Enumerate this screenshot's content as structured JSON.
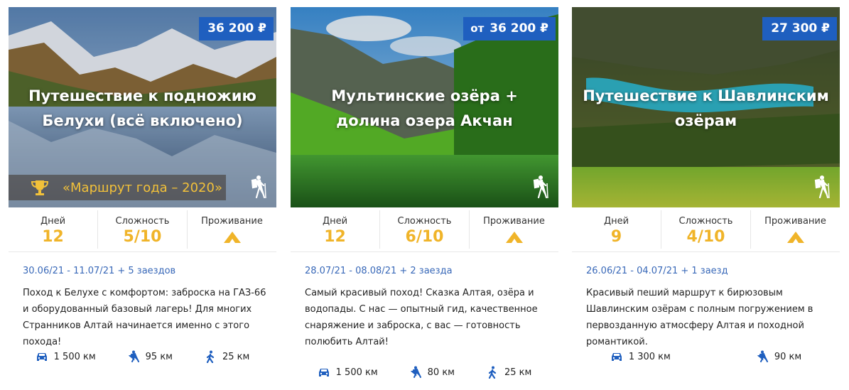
{
  "tours": [
    {
      "price_prefix": "",
      "price": "36 200 ₽",
      "title": "Путешествие к подножию Белухи (всё включено)",
      "award": "«Маршрут года – 2020»",
      "stats": {
        "days_label": "Дней",
        "days": "12",
        "difficulty_label": "Сложность",
        "difficulty": "5/10",
        "lodging_label": "Проживание",
        "lodging_icon": "tent-icon"
      },
      "dates": "30.06/21 - 11.07/21 + 5 заездов",
      "description": "Поход к Белухе с комфортом: заброска на ГАЗ-66 и оборудованный базовый лагерь! Для многих Странников Алтай начинается именно с этого похода!",
      "metrics": {
        "car": "1 500 км",
        "horse": "95 км",
        "walk": "25 км"
      }
    },
    {
      "price_prefix": "от",
      "price": "36 200 ₽",
      "title": "Мультинские озёра + долина озера Акчан",
      "award": "",
      "stats": {
        "days_label": "Дней",
        "days": "12",
        "difficulty_label": "Сложность",
        "difficulty": "6/10",
        "lodging_label": "Проживание",
        "lodging_icon": "tent-icon"
      },
      "dates": "28.07/21 - 08.08/21 + 2 заезда",
      "description": "Самый красивый поход! Сказка Алтая, озёра и водопады. С нас — опытный гид, качественное снаряжение и заброска, с вас — готовность полюбить Алтай!",
      "metrics": {
        "car": "1 500 км",
        "horse": "80 км",
        "walk": "25 км"
      }
    },
    {
      "price_prefix": "",
      "price": "27 300 ₽",
      "title": "Путешествие к Шавлинским озёрам",
      "award": "",
      "stats": {
        "days_label": "Дней",
        "days": "9",
        "difficulty_label": "Сложность",
        "difficulty": "4/10",
        "lodging_label": "Проживание",
        "lodging_icon": "tent-icon"
      },
      "dates": "26.06/21 - 04.07/21 + 1 заезд",
      "description": "Красивый пеший маршрут к бирюзовым Шавлинским озёрам с полным погружением в первозданную атмосферу Алтая и походной романтикой.",
      "metrics": {
        "car": "1 300 км",
        "horse": "90 км",
        "walk": ""
      }
    }
  ],
  "colors": {
    "price_bg": "#1f5fbf",
    "accent_yellow": "#f0b429",
    "date_blue": "#3868b8",
    "icon_blue": "#1f5fbf"
  }
}
